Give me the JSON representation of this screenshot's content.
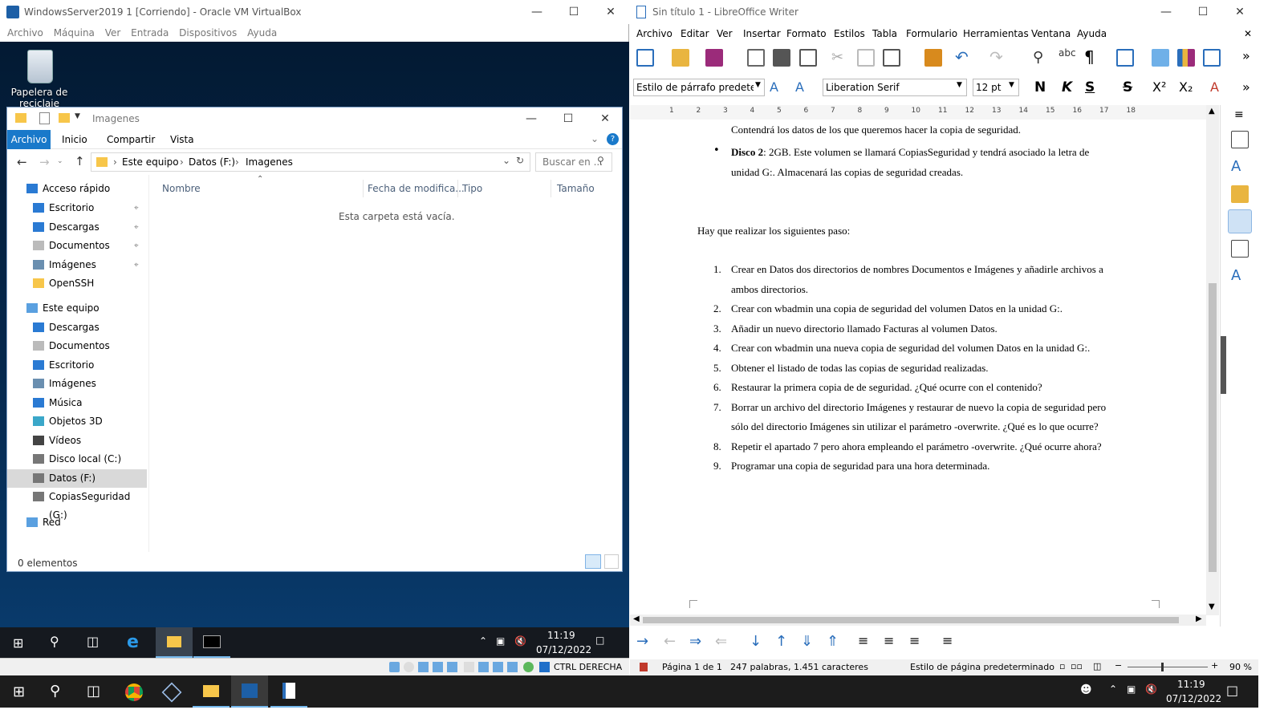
{
  "vbox": {
    "title": "WindowsServer2019 1 [Corriendo] - Oracle VM VirtualBox",
    "menu": [
      "Archivo",
      "Máquina",
      "Ver",
      "Entrada",
      "Dispositivos",
      "Ayuda"
    ],
    "desktop_icon_label": "Papelera de reciclaje",
    "status_key": "CTRL DERECHA"
  },
  "explorer": {
    "title": "Imagenes",
    "ribbon_tabs": [
      "Archivo",
      "Inicio",
      "Compartir",
      "Vista"
    ],
    "breadcrumb": [
      "Este equipo",
      "Datos (F:)",
      "Imagenes"
    ],
    "search_placeholder": "Buscar en ...",
    "columns": [
      "Nombre",
      "Fecha de modifica...",
      "Tipo",
      "Tamaño"
    ],
    "empty_message": "Esta carpeta está vacía.",
    "status": "0 elementos",
    "nav": [
      {
        "label": "Acceso rápido",
        "icon": "star-icon",
        "level": 0,
        "pinned": false,
        "selected": false
      },
      {
        "label": "Escritorio",
        "icon": "desktop-icon",
        "level": 1,
        "pinned": true,
        "selected": false
      },
      {
        "label": "Descargas",
        "icon": "download-icon",
        "level": 1,
        "pinned": true,
        "selected": false
      },
      {
        "label": "Documentos",
        "icon": "document-icon",
        "level": 1,
        "pinned": true,
        "selected": false
      },
      {
        "label": "Imágenes",
        "icon": "pictures-icon",
        "level": 1,
        "pinned": true,
        "selected": false
      },
      {
        "label": "OpenSSH",
        "icon": "folder-icon",
        "level": 1,
        "pinned": false,
        "selected": false
      },
      {
        "label": "Este equipo",
        "icon": "computer-icon",
        "level": 0,
        "pinned": false,
        "selected": false
      },
      {
        "label": "Descargas",
        "icon": "download-icon",
        "level": 1,
        "pinned": false,
        "selected": false
      },
      {
        "label": "Documentos",
        "icon": "document-icon",
        "level": 1,
        "pinned": false,
        "selected": false
      },
      {
        "label": "Escritorio",
        "icon": "desktop-icon",
        "level": 1,
        "pinned": false,
        "selected": false
      },
      {
        "label": "Imágenes",
        "icon": "pictures-icon",
        "level": 1,
        "pinned": false,
        "selected": false
      },
      {
        "label": "Música",
        "icon": "music-icon",
        "level": 1,
        "pinned": false,
        "selected": false
      },
      {
        "label": "Objetos 3D",
        "icon": "cube-icon",
        "level": 1,
        "pinned": false,
        "selected": false
      },
      {
        "label": "Vídeos",
        "icon": "video-icon",
        "level": 1,
        "pinned": false,
        "selected": false
      },
      {
        "label": "Disco local (C:)",
        "icon": "drive-icon",
        "level": 1,
        "pinned": false,
        "selected": false
      },
      {
        "label": "Datos (F:)",
        "icon": "drive-icon",
        "level": 1,
        "pinned": false,
        "selected": true
      },
      {
        "label": "CopiasSeguridad (G:)",
        "icon": "drive-icon",
        "level": 1,
        "pinned": false,
        "selected": false
      },
      {
        "label": "Red",
        "icon": "network-icon",
        "level": 0,
        "pinned": false,
        "selected": false
      }
    ]
  },
  "guest_clock": {
    "time": "11:19",
    "date": "07/12/2022"
  },
  "writer": {
    "title": "Sin título 1 - LibreOffice Writer",
    "menu": [
      "Archivo",
      "Editar",
      "Ver",
      "Insertar",
      "Formato",
      "Estilos",
      "Tabla",
      "Formulario",
      "Herramientas",
      "Ventana",
      "Ayuda"
    ],
    "paragraph_style": "Estilo de párrafo predetermi",
    "font_name": "Liberation Serif",
    "font_size": "12 pt",
    "format_buttons": [
      "N",
      "K",
      "S"
    ],
    "ruler_marks": [
      "1",
      "2",
      "3",
      "4",
      "5",
      "6",
      "7",
      "8",
      "9",
      "10",
      "11",
      "12",
      "13",
      "14",
      "15",
      "16",
      "17",
      "18"
    ],
    "doc": {
      "line1": "Contendrá los datos de los que queremos hacer la copia de seguridad.",
      "bullet_bold": "Disco 2",
      "bullet_rest": ": 2GB. Este volumen se llamará CopiasSeguridad y tendrá asociado la letra de",
      "bullet_line2": "unidad G:. Almacenará las copias de seguridad creadas.",
      "intro": "Hay que realizar los siguientes paso:",
      "steps": [
        {
          "n": "1.",
          "text": "Crear en Datos dos directorios de nombres Documentos e Imágenes y añadirle archivos a",
          "cont": "ambos directorios."
        },
        {
          "n": "2.",
          "text": "Crear con wbadmin una copia de seguridad del volumen Datos en la unidad G:.",
          "cont": ""
        },
        {
          "n": "3.",
          "text": "Añadir un nuevo directorio llamado Facturas al volumen Datos.",
          "cont": ""
        },
        {
          "n": "4.",
          "text": "Crear con wbadmin una nueva copia de seguridad del volumen Datos en la unidad G:.",
          "cont": ""
        },
        {
          "n": "5.",
          "text": "Obtener el listado de todas las copias de seguridad realizadas.",
          "cont": ""
        },
        {
          "n": "6.",
          "text": "Restaurar la primera copia de de seguridad. ¿Qué ocurre con el contenido?",
          "cont": ""
        },
        {
          "n": "7.",
          "text": "Borrar un archivo del directorio Imágenes y restaurar de nuevo la copia de seguridad pero",
          "cont": "sólo del directorio Imágenes sin utilizar el parámetro -overwrite. ¿Qué es lo que ocurre?"
        },
        {
          "n": "8.",
          "text": "Repetir el apartado 7 pero ahora empleando el parámetro -overwrite. ¿Qué ocurre ahora?",
          "cont": ""
        },
        {
          "n": "9.",
          "text": "Programar una copia de seguridad para una hora determinada.",
          "cont": ""
        }
      ]
    },
    "status": {
      "page": "Página 1 de 1",
      "words": "247 palabras, 1.451 caracteres",
      "page_style": "Estilo de página predeterminado",
      "zoom": "90 %"
    }
  },
  "host_clock": {
    "time": "11:19",
    "date": "07/12/2022"
  },
  "colors": {
    "accent": "#0078d7",
    "writer_icon": "#2a6ebb",
    "guest_bg": "#05284d"
  }
}
